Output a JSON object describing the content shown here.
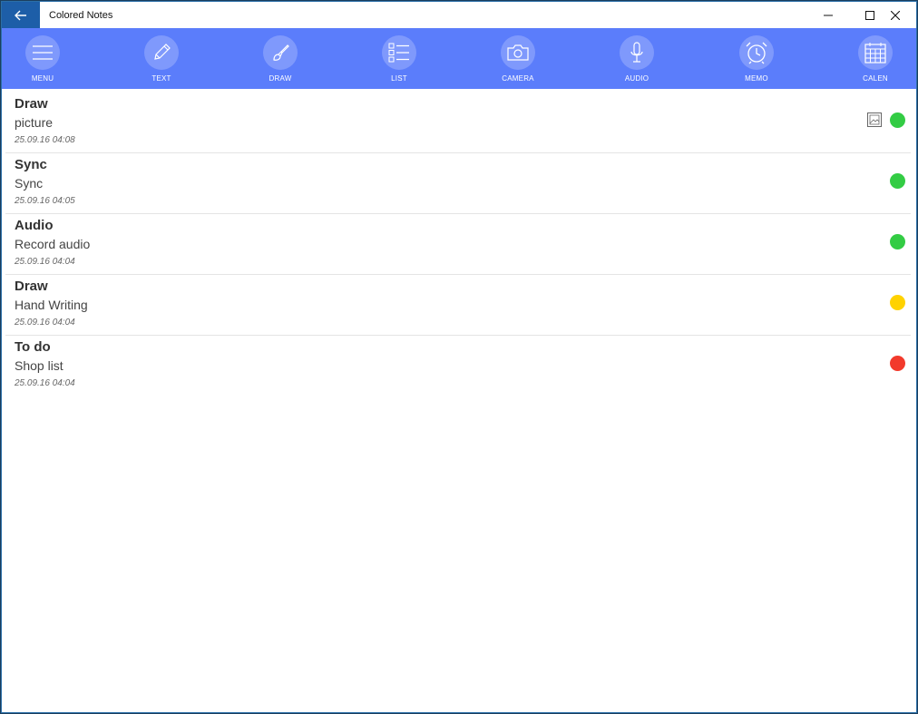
{
  "window": {
    "title": "Colored Notes"
  },
  "toolbar": {
    "items": [
      {
        "label": "MENU",
        "icon": "menu-icon"
      },
      {
        "label": "TEXT",
        "icon": "pencil-icon"
      },
      {
        "label": "DRAW",
        "icon": "brush-icon"
      },
      {
        "label": "LIST",
        "icon": "checklist-icon"
      },
      {
        "label": "CAMERA",
        "icon": "camera-icon"
      },
      {
        "label": "AUDIO",
        "icon": "microphone-icon"
      },
      {
        "label": "MEMO",
        "icon": "alarm-clock-icon"
      },
      {
        "label": "CALEN",
        "icon": "calendar-icon"
      }
    ]
  },
  "notes": [
    {
      "title": "Draw",
      "body": "picture",
      "date": "25.09.16 04:08",
      "color": "#33cc44",
      "has_image": true
    },
    {
      "title": "Sync",
      "body": "Sync",
      "date": "25.09.16 04:05",
      "color": "#33cc44",
      "has_image": false
    },
    {
      "title": "Audio",
      "body": "Record audio",
      "date": "25.09.16 04:04",
      "color": "#33cc44",
      "has_image": false
    },
    {
      "title": "Draw",
      "body": "Hand Writing",
      "date": "25.09.16 04:04",
      "color": "#ffd200",
      "has_image": false
    },
    {
      "title": "To do",
      "body": "Shop list",
      "date": "25.09.16 04:04",
      "color": "#f23a2c",
      "has_image": false
    }
  ],
  "colors": {
    "toolbar": "#5b7dfb",
    "back_button": "#1d5ea8"
  }
}
